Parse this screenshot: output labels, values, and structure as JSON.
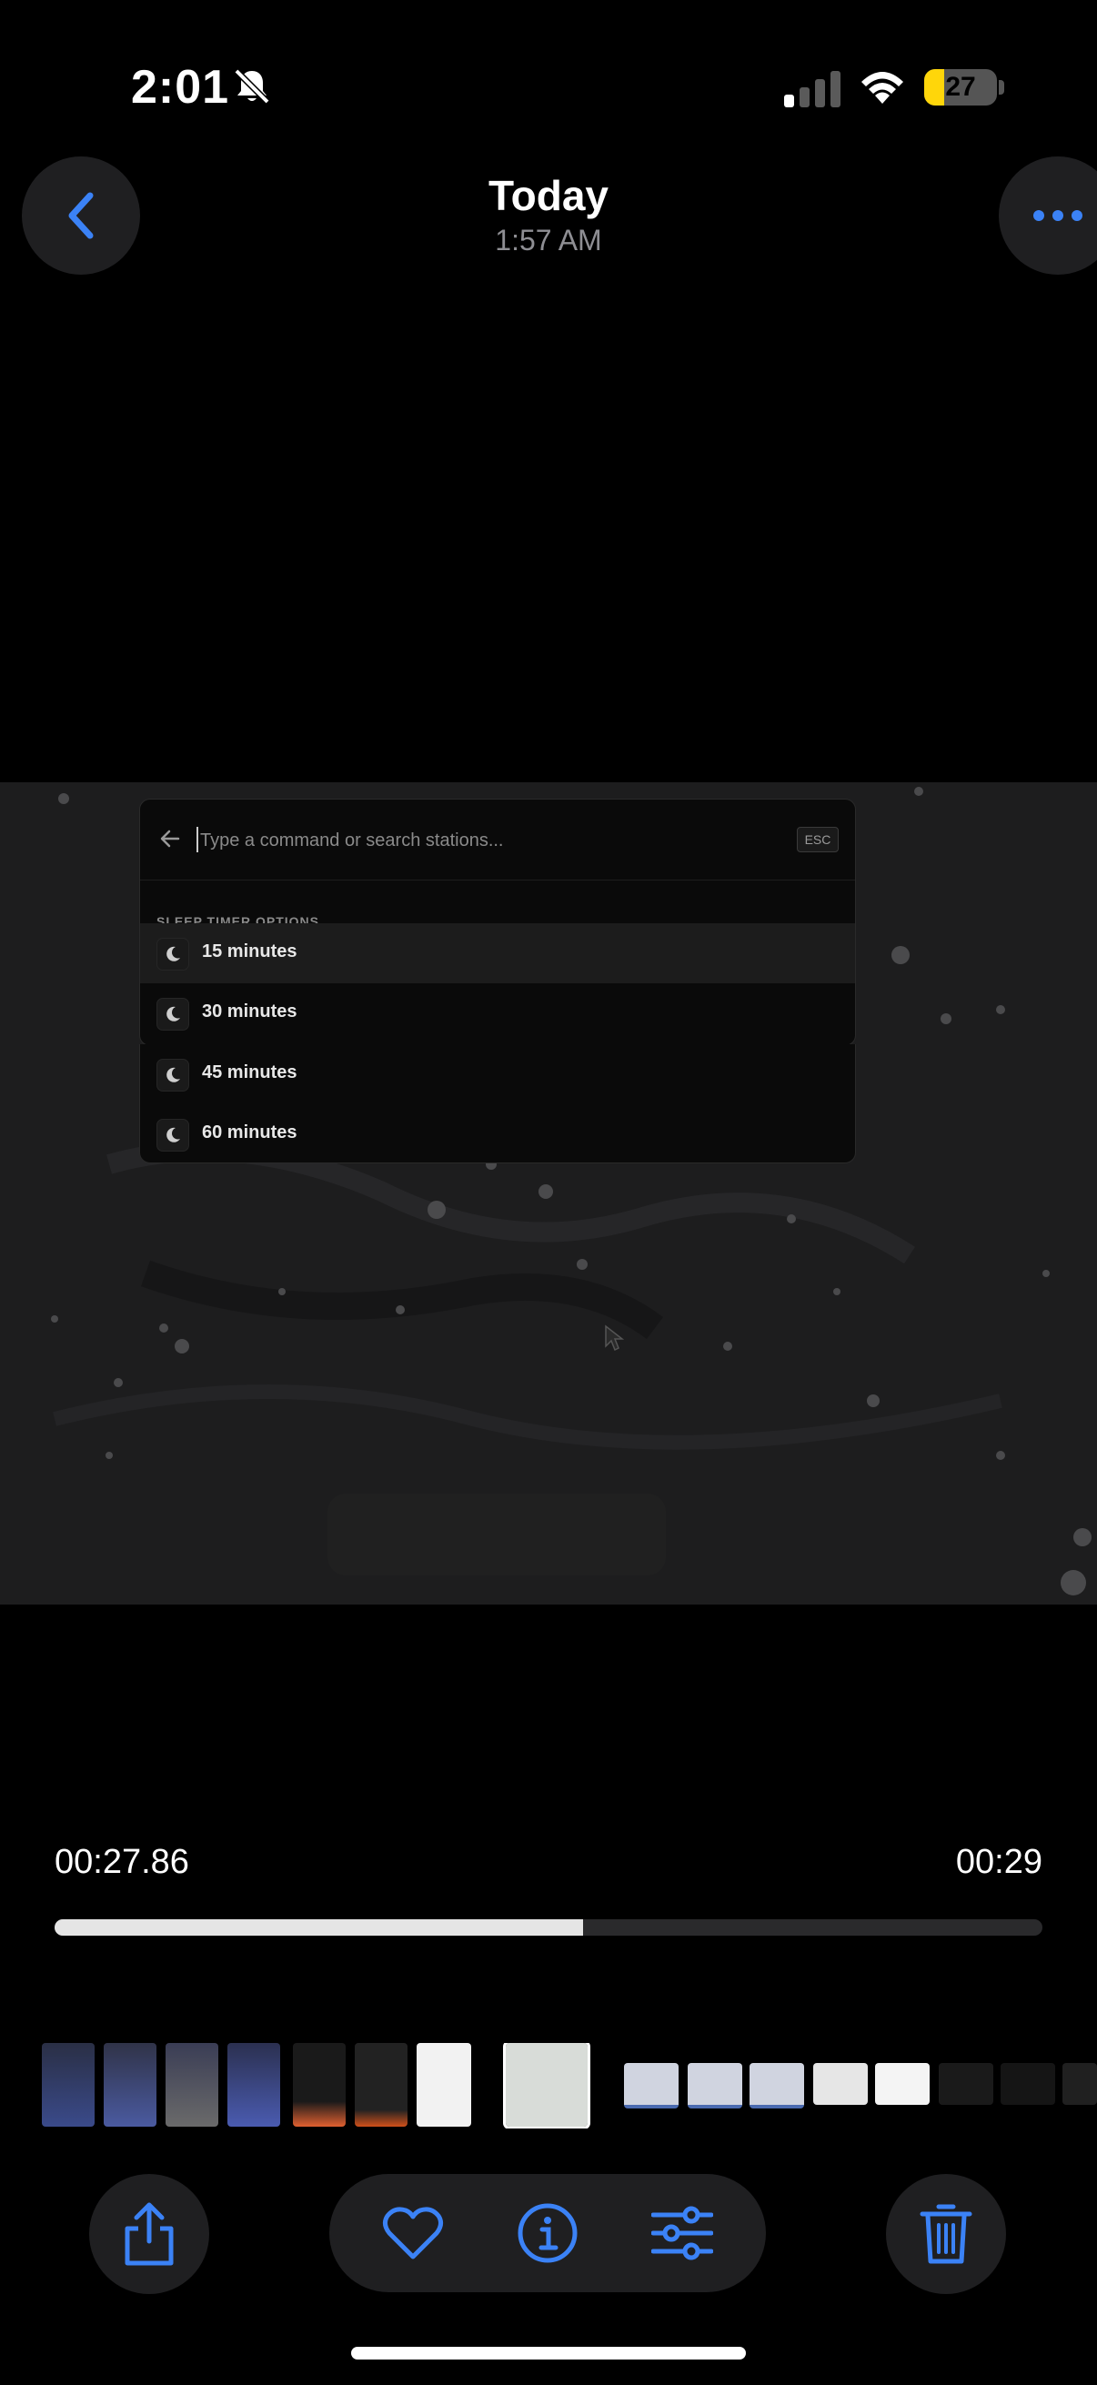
{
  "status_bar": {
    "time": "2:01",
    "battery_level": "27",
    "battery_percent": 27,
    "icons": [
      "bell-slash-icon",
      "cellular-signal-icon",
      "wifi-icon",
      "battery-icon"
    ]
  },
  "header": {
    "title": "Today",
    "subtitle": "1:57 AM",
    "back_icon": "chevron-left-icon",
    "more_icon": "ellipsis-icon"
  },
  "video_frame": {
    "command_palette": {
      "placeholder": "Type a command or search stations...",
      "esc_label": "ESC",
      "section_title": "SLEEP TIMER OPTIONS",
      "items": [
        {
          "label": "15 minutes",
          "icon": "moon-icon",
          "highlighted": true
        },
        {
          "label": "30 minutes",
          "icon": "moon-icon",
          "highlighted": false
        },
        {
          "label": "45 minutes",
          "icon": "moon-icon",
          "highlighted": false
        },
        {
          "label": "60 minutes",
          "icon": "moon-icon",
          "highlighted": false
        }
      ]
    }
  },
  "scrubber": {
    "elapsed": "00:27.86",
    "duration": "00:29",
    "progress_percent": 53.5
  },
  "toolbar": {
    "share_icon": "share-icon",
    "favorite_icon": "heart-icon",
    "info_icon": "info-icon",
    "adjust_icon": "sliders-icon",
    "delete_icon": "trash-icon"
  },
  "colors": {
    "accent": "#3b82f6",
    "background": "#000000",
    "button_bg": "#1f1f21",
    "battery_fill": "#ffd60a"
  }
}
